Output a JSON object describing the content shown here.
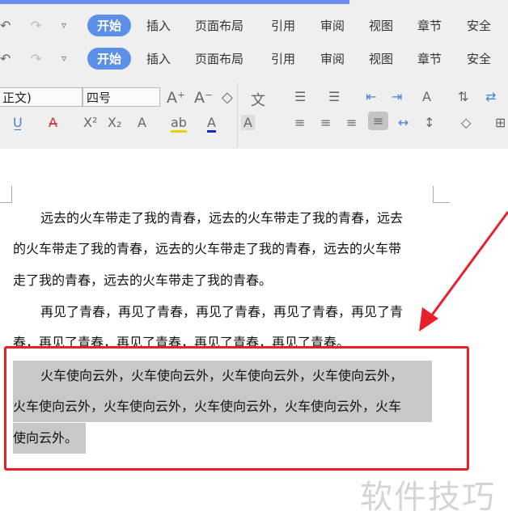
{
  "ribbon": {
    "tabs": [
      "开始",
      "插入",
      "页面布局",
      "引用",
      "审阅",
      "视图",
      "章节",
      "安全"
    ],
    "font_name": "正文)",
    "font_size": "四号"
  },
  "document": {
    "lines": [
      "远去的火车带走了我的青春，远去的火车带走了我的青春，远去",
      "的火车带走了我的青春，远去的火车带走了我的青春，远去的火车带",
      "走了我的青春，远去的火车带走了我的青春。",
      "再见了青春，再见了青春，再见了青春，再见了青春，再见了青",
      "春，再见了青春，再见了青春，再见了青春，再见了青春。",
      "火车使向云外，火车使向云外，火车使向云外，火车使向云外，",
      "火车使向云外，火车使向云外，火车使向云外，火车使向云外，火车",
      "使向云外。"
    ]
  },
  "watermark": "软件技巧",
  "colors": {
    "accent": "#5b8fe8",
    "annotation": "#e8202a",
    "highlight": "#c8c8c8"
  }
}
